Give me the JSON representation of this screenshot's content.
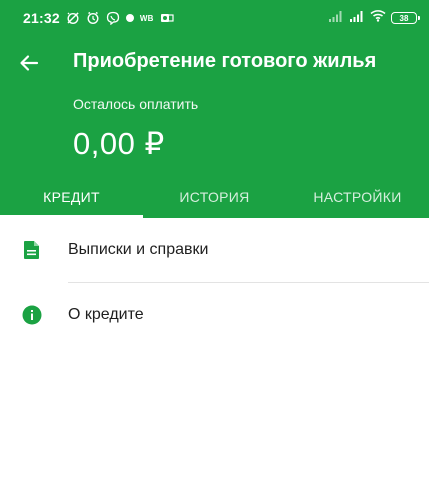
{
  "status_bar": {
    "time": "21:32",
    "carrier_badge": "WB",
    "battery": "38",
    "icons": [
      "no-alarm-icon",
      "alarm-icon",
      "viber-icon",
      "dot-icon",
      "outlook-icon",
      "signal-icon",
      "signal-icon",
      "wifi-icon",
      "battery-icon"
    ]
  },
  "header": {
    "title": "Приобретение готового жилья",
    "remaining_label": "Осталось оплатить",
    "amount": "0,00 ₽",
    "back_icon": "arrow-left-icon"
  },
  "tabs": [
    {
      "label": "КРЕДИТ",
      "active": true
    },
    {
      "label": "ИСТОРИЯ",
      "active": false
    },
    {
      "label": "НАСТРОЙКИ",
      "active": false
    }
  ],
  "menu": [
    {
      "label": "Выписки и справки",
      "icon": "document-icon"
    },
    {
      "label": "О кредите",
      "icon": "info-icon"
    }
  ],
  "colors": {
    "brand_green": "#1ba243",
    "text_dark": "#1f1f1f",
    "divider": "#e3e3e3"
  }
}
